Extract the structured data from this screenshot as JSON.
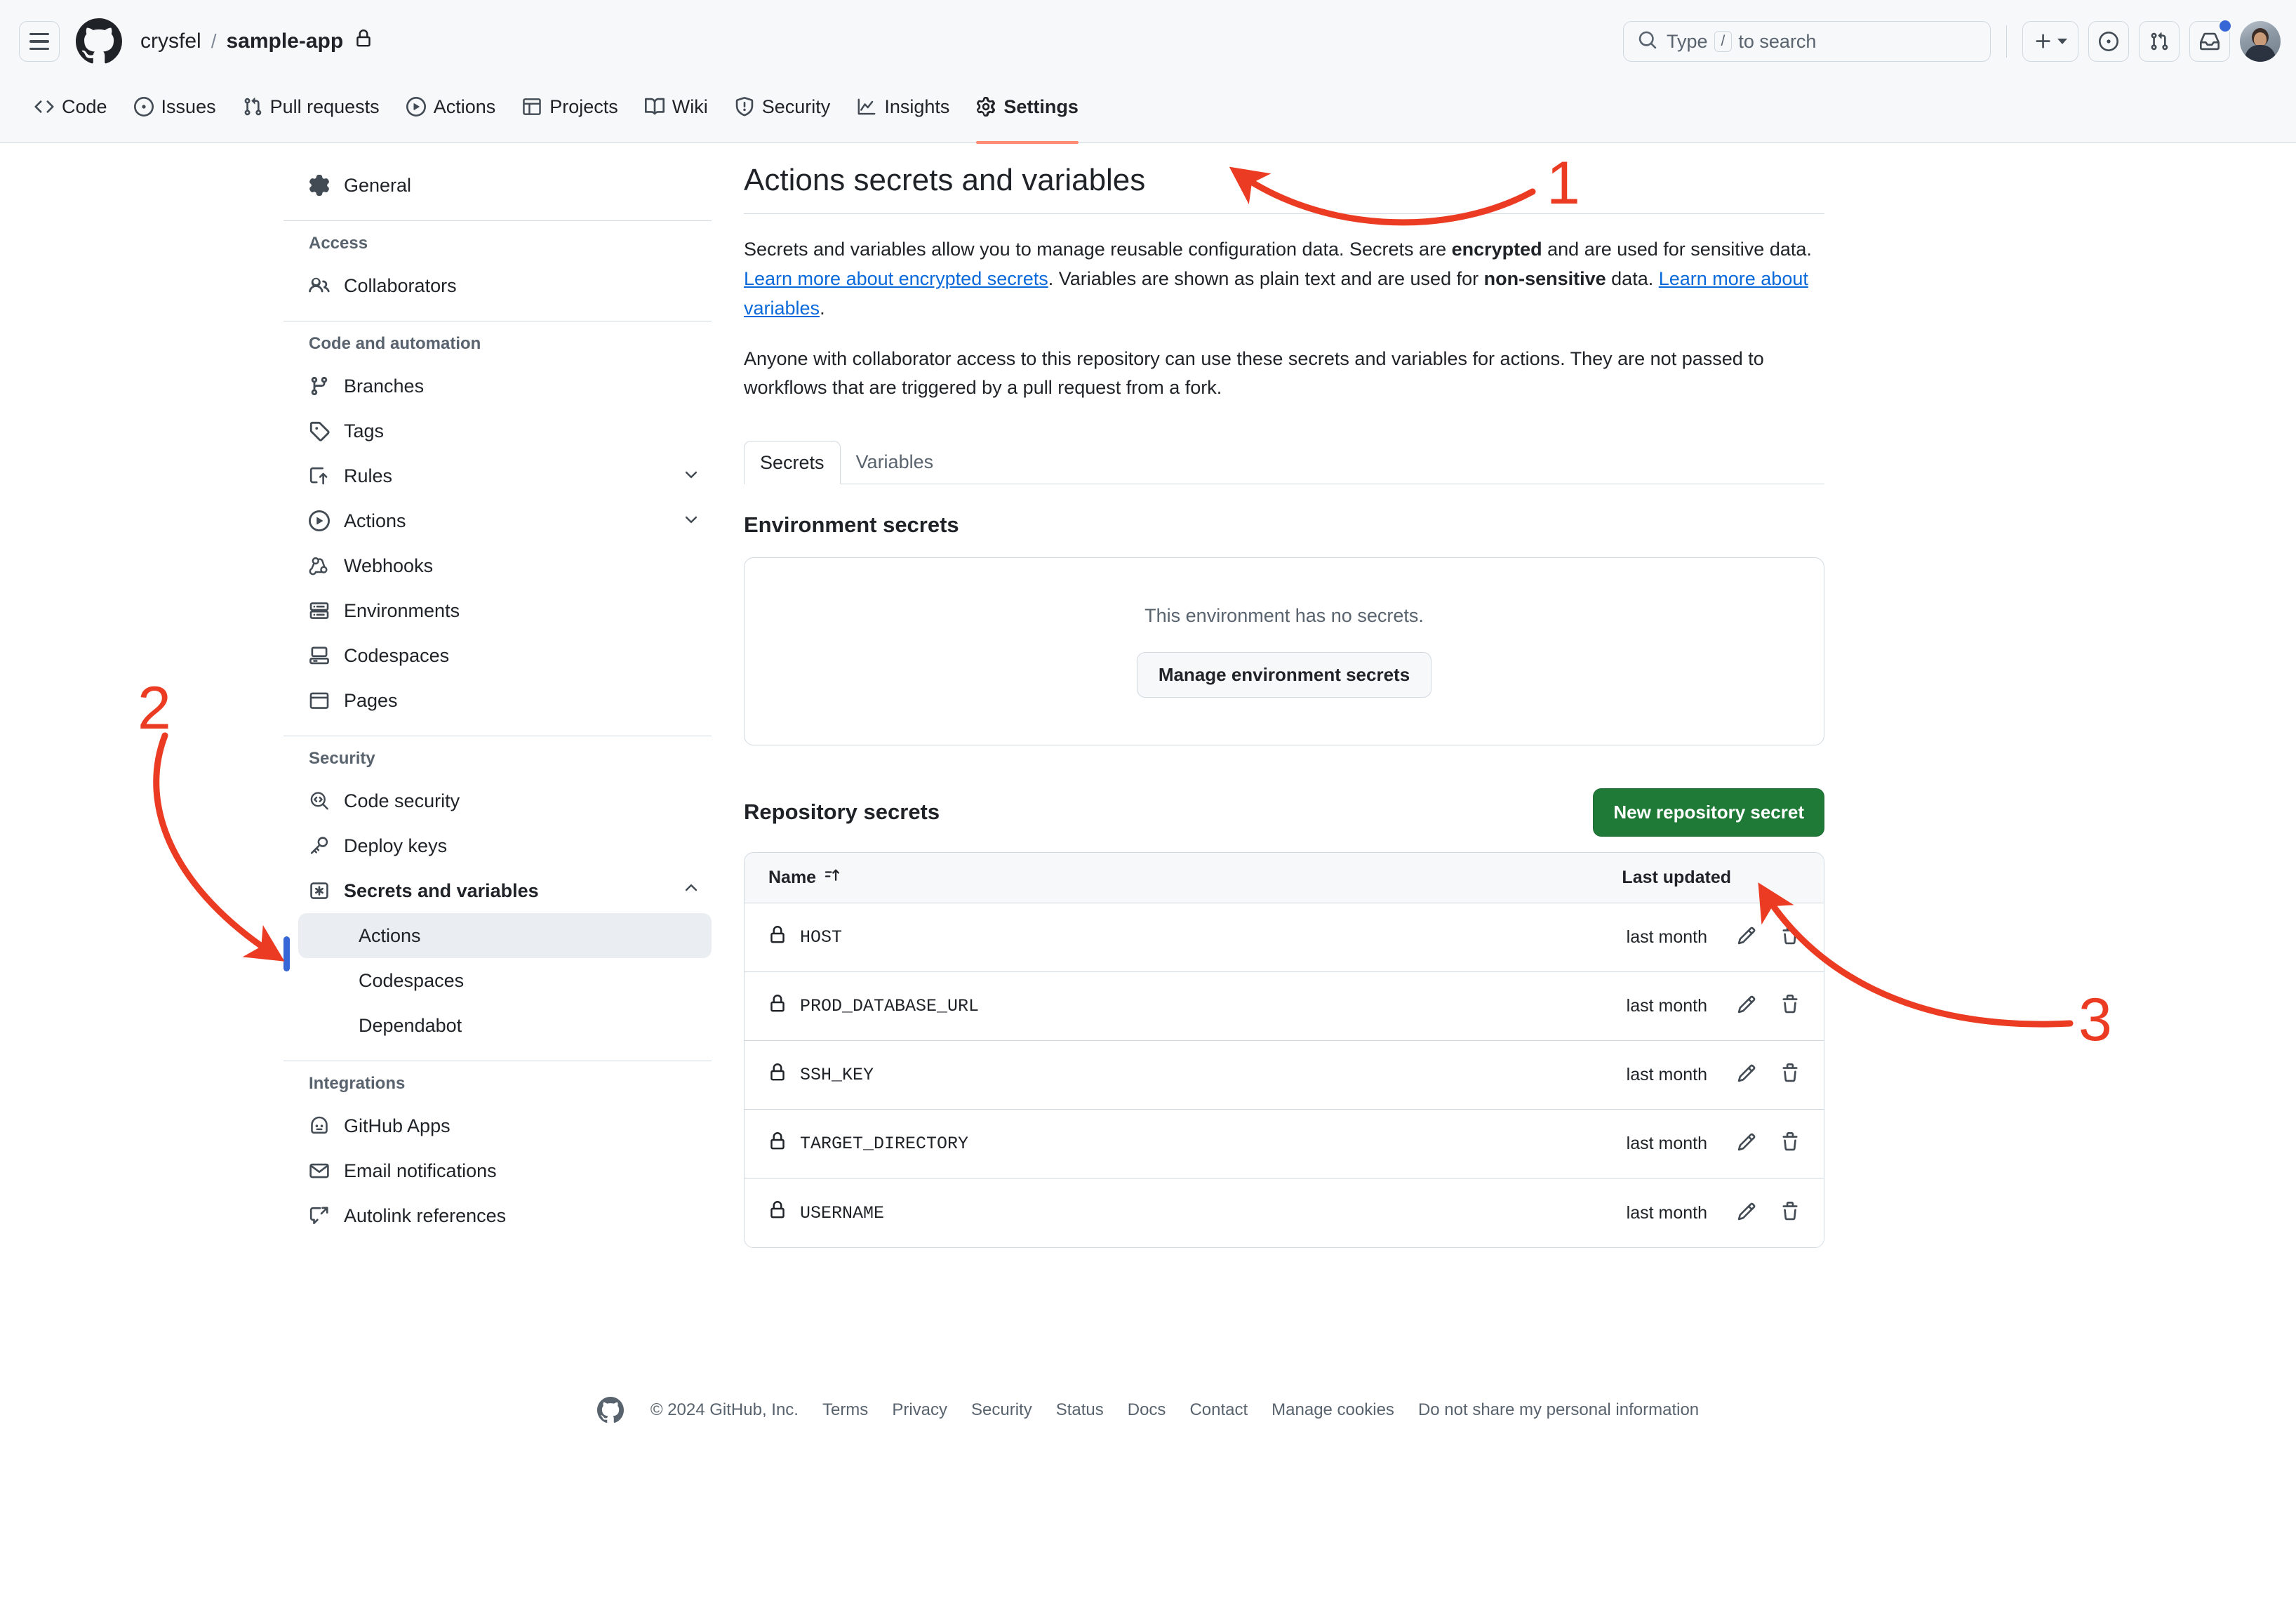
{
  "header": {
    "menu_icon": "hamburger-icon",
    "logo_icon": "github-logo-icon",
    "owner": "crysfel",
    "separator": "/",
    "repo": "sample-app",
    "repo_visibility_icon": "lock-icon",
    "search": {
      "placeholder_prefix": "Type",
      "key_hint": "/",
      "placeholder_suffix": "to search",
      "icon": "search-icon"
    },
    "actions": [
      {
        "name": "create-new-button",
        "icon": "plus-icon",
        "caret": "chevron-down-icon"
      },
      {
        "name": "issues-button",
        "icon": "issue-opened-icon"
      },
      {
        "name": "pull-requests-button",
        "icon": "git-pull-request-icon"
      },
      {
        "name": "notifications-button",
        "icon": "inbox-icon",
        "has_badge": true
      }
    ],
    "avatar_alt": "user-avatar"
  },
  "repo_nav": {
    "tabs": [
      {
        "label": "Code",
        "icon": "code-icon",
        "active": false
      },
      {
        "label": "Issues",
        "icon": "issue-opened-icon",
        "active": false
      },
      {
        "label": "Pull requests",
        "icon": "git-pull-request-icon",
        "active": false
      },
      {
        "label": "Actions",
        "icon": "play-icon",
        "active": false
      },
      {
        "label": "Projects",
        "icon": "table-icon",
        "active": false
      },
      {
        "label": "Wiki",
        "icon": "book-icon",
        "active": false
      },
      {
        "label": "Security",
        "icon": "shield-icon",
        "active": false
      },
      {
        "label": "Insights",
        "icon": "graph-icon",
        "active": false
      },
      {
        "label": "Settings",
        "icon": "gear-icon",
        "active": true
      }
    ]
  },
  "sidebar": {
    "general": {
      "label": "General",
      "icon": "gear-icon"
    },
    "groups": [
      {
        "heading": "Access",
        "items": [
          {
            "label": "Collaborators",
            "icon": "people-icon"
          }
        ]
      },
      {
        "heading": "Code and automation",
        "items": [
          {
            "label": "Branches",
            "icon": "git-branch-icon"
          },
          {
            "label": "Tags",
            "icon": "tag-icon"
          },
          {
            "label": "Rules",
            "icon": "rules-icon",
            "expandable": true
          },
          {
            "label": "Actions",
            "icon": "play-icon",
            "expandable": true
          },
          {
            "label": "Webhooks",
            "icon": "webhook-icon"
          },
          {
            "label": "Environments",
            "icon": "server-icon"
          },
          {
            "label": "Codespaces",
            "icon": "codespaces-icon"
          },
          {
            "label": "Pages",
            "icon": "browser-icon"
          }
        ]
      },
      {
        "heading": "Security",
        "items": [
          {
            "label": "Code security",
            "icon": "code-search-icon"
          },
          {
            "label": "Deploy keys",
            "icon": "key-icon"
          },
          {
            "label": "Secrets and variables",
            "icon": "asterisk-key-icon",
            "expandable": true,
            "expanded": true,
            "bold": true
          }
        ],
        "subitems": [
          {
            "label": "Actions",
            "selected": true
          },
          {
            "label": "Codespaces",
            "selected": false
          },
          {
            "label": "Dependabot",
            "selected": false
          }
        ]
      },
      {
        "heading": "Integrations",
        "items": [
          {
            "label": "GitHub Apps",
            "icon": "apps-icon"
          },
          {
            "label": "Email notifications",
            "icon": "mail-icon"
          },
          {
            "label": "Autolink references",
            "icon": "link-external-icon"
          }
        ]
      }
    ]
  },
  "main": {
    "title": "Actions secrets and variables",
    "intro_p1_a": "Secrets and variables allow you to manage reusable configuration data. Secrets are ",
    "intro_p1_b": "encrypted",
    "intro_p1_c": " and are used for sensitive data. ",
    "intro_link1": "Learn more about encrypted secrets",
    "intro_p1_d": ". Variables are shown as plain text and are used for ",
    "intro_p1_e": "non-sensitive",
    "intro_p1_f": " data. ",
    "intro_link2": "Learn more about variables",
    "intro_p1_g": ".",
    "intro_p2": "Anyone with collaborator access to this repository can use these secrets and variables for actions. They are not passed to workflows that are triggered by a pull request from a fork.",
    "tabs": [
      {
        "label": "Secrets",
        "active": true
      },
      {
        "label": "Variables",
        "active": false
      }
    ],
    "environment_secrets": {
      "title": "Environment secrets",
      "empty_text": "This environment has no secrets.",
      "manage_button": "Manage environment secrets"
    },
    "repository_secrets": {
      "title": "Repository secrets",
      "new_button": "New repository secret",
      "columns": {
        "name": "Name",
        "sort_icon": "sort-asc-icon",
        "last_updated": "Last updated"
      },
      "rows": [
        {
          "icon": "lock-icon",
          "name": "HOST",
          "last_updated": "last month",
          "edit_icon": "pencil-icon",
          "delete_icon": "trash-icon"
        },
        {
          "icon": "lock-icon",
          "name": "PROD_DATABASE_URL",
          "last_updated": "last month",
          "edit_icon": "pencil-icon",
          "delete_icon": "trash-icon"
        },
        {
          "icon": "lock-icon",
          "name": "SSH_KEY",
          "last_updated": "last month",
          "edit_icon": "pencil-icon",
          "delete_icon": "trash-icon"
        },
        {
          "icon": "lock-icon",
          "name": "TARGET_DIRECTORY",
          "last_updated": "last month",
          "edit_icon": "pencil-icon",
          "delete_icon": "trash-icon"
        },
        {
          "icon": "lock-icon",
          "name": "USERNAME",
          "last_updated": "last month",
          "edit_icon": "pencil-icon",
          "delete_icon": "trash-icon"
        }
      ]
    }
  },
  "footer": {
    "logo_icon": "github-mark-icon",
    "copyright": "© 2024 GitHub, Inc.",
    "links": [
      "Terms",
      "Privacy",
      "Security",
      "Status",
      "Docs",
      "Contact",
      "Manage cookies",
      "Do not share my personal information"
    ]
  },
  "annotations": [
    {
      "number": "1",
      "target": "settings-tab"
    },
    {
      "number": "2",
      "target": "sidebar-actions-subitem"
    },
    {
      "number": "3",
      "target": "new-repository-secret-button"
    }
  ],
  "colors": {
    "accent_green": "#1f7a37",
    "accent_blue": "#0969da",
    "annotation_red": "#eb3b22",
    "active_tab_underline": "#fd8c73",
    "selected_indicator": "#3767d6"
  }
}
